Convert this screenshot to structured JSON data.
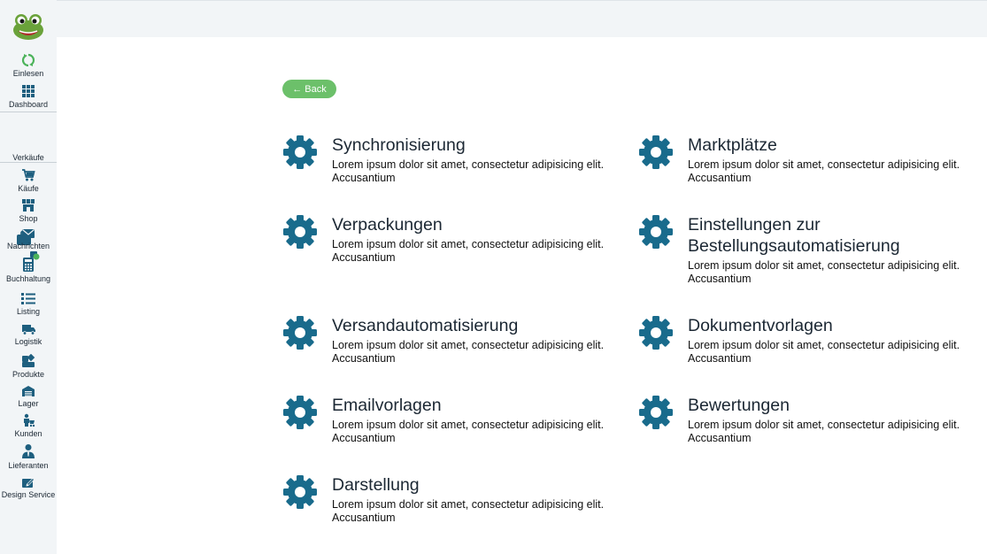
{
  "sidebar": {
    "items": [
      {
        "id": "einlesen",
        "label": "Einlesen",
        "icon": "refresh-icon"
      },
      {
        "id": "dashboard",
        "label": "Dashboard",
        "icon": "grid-icon"
      },
      {
        "id": "verkaufe",
        "label": "Verkäufe",
        "icon": "shopping-bag-icon"
      },
      {
        "id": "kaufe",
        "label": "Käufe",
        "icon": "cart-icon"
      },
      {
        "id": "shop",
        "label": "Shop",
        "icon": "store-icon"
      },
      {
        "id": "nachrichten",
        "label": "Nachrichten",
        "icon": "envelope-icon"
      },
      {
        "id": "buchhaltung",
        "label": "Buchhaltung",
        "icon": "calculator-icon"
      },
      {
        "id": "listing",
        "label": "Listing",
        "icon": "list-icon"
      },
      {
        "id": "logistik",
        "label": "Logistik",
        "icon": "truck-icon"
      },
      {
        "id": "produkte",
        "label": "Produkte",
        "icon": "shapes-icon"
      },
      {
        "id": "lager",
        "label": "Lager",
        "icon": "warehouse-icon"
      },
      {
        "id": "kunden",
        "label": "Kunden",
        "icon": "customer-icon"
      },
      {
        "id": "lieferanten",
        "label": "Lieferanten",
        "icon": "user-tie-icon"
      },
      {
        "id": "design",
        "label": "Design Service",
        "icon": "pen-square-icon"
      }
    ]
  },
  "back_label": "← Back",
  "settings": [
    {
      "title": "Synchronisierung",
      "desc": "Lorem ipsum dolor sit amet, consectetur adipisicing elit. Accusantium"
    },
    {
      "title": "Marktplätze",
      "desc": "Lorem ipsum dolor sit amet, consectetur adipisicing elit. Accusantium"
    },
    {
      "title": "Verpackungen",
      "desc": "Lorem ipsum dolor sit amet, consectetur adipisicing elit. Accusantium"
    },
    {
      "title": "Einstellungen zur Bestellungsautomatisierung",
      "desc": "Lorem ipsum dolor sit amet, consectetur adipisicing elit. Accusantium"
    },
    {
      "title": "Versandautomatisierung",
      "desc": "Lorem ipsum dolor sit amet, consectetur adipisicing elit. Accusantium"
    },
    {
      "title": "Dokumentvorlagen",
      "desc": "Lorem ipsum dolor sit amet, consectetur adipisicing elit. Accusantium"
    },
    {
      "title": "Emailvorlagen",
      "desc": "Lorem ipsum dolor sit amet, consectetur adipisicing elit. Accusantium"
    },
    {
      "title": "Bewertungen",
      "desc": "Lorem ipsum dolor sit amet, consectetur adipisicing elit. Accusantium"
    },
    {
      "title": "Darstellung",
      "desc": "Lorem ipsum dolor sit amet, consectetur adipisicing elit. Accusantium"
    }
  ],
  "colors": {
    "gear": "#196b8c",
    "icon": "#1e5f7f",
    "back_button": "#6cc06a",
    "sidebar_bg": "#f2f5f7",
    "accent_green": "#4cb35a"
  }
}
